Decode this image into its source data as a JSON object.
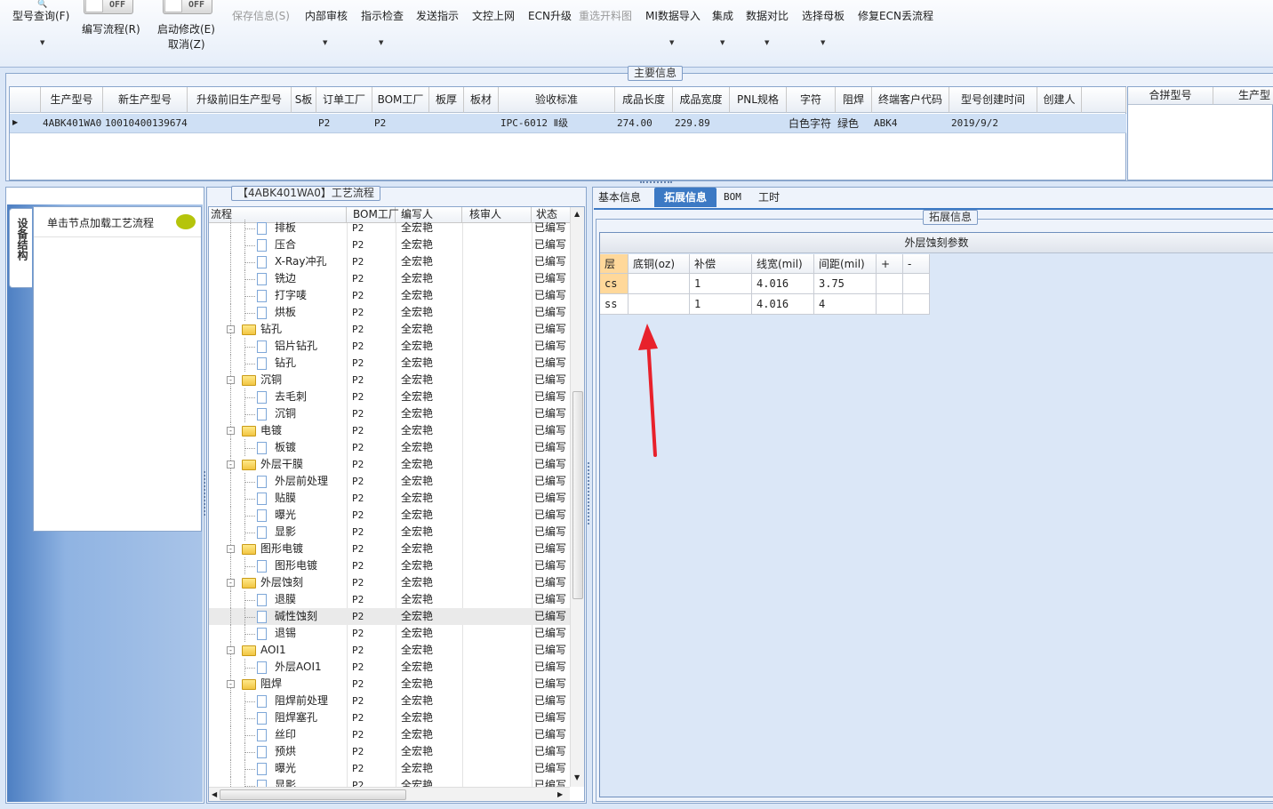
{
  "ribbon": {
    "items": [
      {
        "label": "型号查询(F)",
        "disabled": false
      },
      {
        "label": "编写流程(R)",
        "disabled": false
      },
      {
        "label": "启动修改(E)",
        "disabled": false
      },
      {
        "label": "取消(Z)",
        "disabled": false
      },
      {
        "label": "保存信息(S)",
        "disabled": true
      },
      {
        "label": "内部审核",
        "disabled": false
      },
      {
        "label": "指示检查",
        "disabled": false
      },
      {
        "label": "发送指示",
        "disabled": false
      },
      {
        "label": "文控上网",
        "disabled": false
      },
      {
        "label": "ECN升级",
        "disabled": false
      },
      {
        "label": "重选开料图",
        "disabled": true
      },
      {
        "label": "MI数据导入",
        "disabled": false
      },
      {
        "label": "集成",
        "disabled": false
      },
      {
        "label": "数据对比",
        "disabled": false
      },
      {
        "label": "选择母板",
        "disabled": false
      },
      {
        "label": "修复ECN丢流程",
        "disabled": false
      }
    ],
    "toggle_text": "OFF"
  },
  "main_info": {
    "caption": "主要信息",
    "columns": [
      "生产型号",
      "新生产型号",
      "升级前旧生产型号",
      "S板",
      "订单工厂",
      "BOM工厂",
      "板厚",
      "板材",
      "验收标准",
      "成品长度",
      "成品宽度",
      "PNL规格",
      "字符",
      "阻焊",
      "终端客户代码",
      "型号创建时间",
      "创建人"
    ],
    "row": [
      "4ABK401WA0",
      "10010400139674",
      "",
      "",
      "P2",
      "P2",
      "",
      "",
      "IPC-6012 Ⅱ级",
      "274.00",
      "229.89",
      "",
      "白色字符",
      "绿色",
      "ABK4",
      "2019/9/2",
      ""
    ],
    "side_columns": [
      "合拼型号",
      "生产型"
    ]
  },
  "left_panel": {
    "side_tab": "设备结构",
    "load_hint": "单击节点加载工艺流程"
  },
  "process": {
    "caption": "【4ABK401WA0】工艺流程",
    "columns": [
      "流程",
      "BOM工厂",
      "编写人",
      "核审人",
      "状态"
    ],
    "rows": [
      {
        "name": "排板",
        "level": 2,
        "bom": "P2",
        "author": "全宏艳",
        "reviewer": "",
        "status": "已编写"
      },
      {
        "name": "压合",
        "level": 2,
        "bom": "P2",
        "author": "全宏艳",
        "reviewer": "",
        "status": "已编写"
      },
      {
        "name": "X-Ray冲孔",
        "level": 2,
        "bom": "P2",
        "author": "全宏艳",
        "reviewer": "",
        "status": "已编写"
      },
      {
        "name": "铣边",
        "level": 2,
        "bom": "P2",
        "author": "全宏艳",
        "reviewer": "",
        "status": "已编写"
      },
      {
        "name": "打字唛",
        "level": 2,
        "bom": "P2",
        "author": "全宏艳",
        "reviewer": "",
        "status": "已编写"
      },
      {
        "name": "烘板",
        "level": 2,
        "bom": "P2",
        "author": "全宏艳",
        "reviewer": "",
        "status": "已编写"
      },
      {
        "name": "钻孔",
        "level": 1,
        "bom": "P2",
        "author": "全宏艳",
        "reviewer": "",
        "status": "已编写"
      },
      {
        "name": "铝片钻孔",
        "level": 2,
        "bom": "P2",
        "author": "全宏艳",
        "reviewer": "",
        "status": "已编写"
      },
      {
        "name": "钻孔",
        "level": 2,
        "bom": "P2",
        "author": "全宏艳",
        "reviewer": "",
        "status": "已编写"
      },
      {
        "name": "沉铜",
        "level": 1,
        "bom": "P2",
        "author": "全宏艳",
        "reviewer": "",
        "status": "已编写"
      },
      {
        "name": "去毛刺",
        "level": 2,
        "bom": "P2",
        "author": "全宏艳",
        "reviewer": "",
        "status": "已编写"
      },
      {
        "name": "沉铜",
        "level": 2,
        "bom": "P2",
        "author": "全宏艳",
        "reviewer": "",
        "status": "已编写"
      },
      {
        "name": "电镀",
        "level": 1,
        "bom": "P2",
        "author": "全宏艳",
        "reviewer": "",
        "status": "已编写"
      },
      {
        "name": "板镀",
        "level": 2,
        "bom": "P2",
        "author": "全宏艳",
        "reviewer": "",
        "status": "已编写"
      },
      {
        "name": "外层干膜",
        "level": 1,
        "bom": "P2",
        "author": "全宏艳",
        "reviewer": "",
        "status": "已编写"
      },
      {
        "name": "外层前处理",
        "level": 2,
        "bom": "P2",
        "author": "全宏艳",
        "reviewer": "",
        "status": "已编写"
      },
      {
        "name": "贴膜",
        "level": 2,
        "bom": "P2",
        "author": "全宏艳",
        "reviewer": "",
        "status": "已编写"
      },
      {
        "name": "曝光",
        "level": 2,
        "bom": "P2",
        "author": "全宏艳",
        "reviewer": "",
        "status": "已编写"
      },
      {
        "name": "显影",
        "level": 2,
        "bom": "P2",
        "author": "全宏艳",
        "reviewer": "",
        "status": "已编写"
      },
      {
        "name": "图形电镀",
        "level": 1,
        "bom": "P2",
        "author": "全宏艳",
        "reviewer": "",
        "status": "已编写"
      },
      {
        "name": "图形电镀",
        "level": 2,
        "bom": "P2",
        "author": "全宏艳",
        "reviewer": "",
        "status": "已编写"
      },
      {
        "name": "外层蚀刻",
        "level": 1,
        "bom": "P2",
        "author": "全宏艳",
        "reviewer": "",
        "status": "已编写"
      },
      {
        "name": "退膜",
        "level": 2,
        "bom": "P2",
        "author": "全宏艳",
        "reviewer": "",
        "status": "已编写"
      },
      {
        "name": "碱性蚀刻",
        "level": 2,
        "bom": "P2",
        "author": "全宏艳",
        "reviewer": "",
        "status": "已编写",
        "selected": true
      },
      {
        "name": "退锡",
        "level": 2,
        "bom": "P2",
        "author": "全宏艳",
        "reviewer": "",
        "status": "已编写"
      },
      {
        "name": "AOI1",
        "level": 1,
        "bom": "P2",
        "author": "全宏艳",
        "reviewer": "",
        "status": "已编写"
      },
      {
        "name": "外层AOI1",
        "level": 2,
        "bom": "P2",
        "author": "全宏艳",
        "reviewer": "",
        "status": "已编写"
      },
      {
        "name": "阻焊",
        "level": 1,
        "bom": "P2",
        "author": "全宏艳",
        "reviewer": "",
        "status": "已编写"
      },
      {
        "name": "阻焊前处理",
        "level": 2,
        "bom": "P2",
        "author": "全宏艳",
        "reviewer": "",
        "status": "已编写"
      },
      {
        "name": "阻焊塞孔",
        "level": 2,
        "bom": "P2",
        "author": "全宏艳",
        "reviewer": "",
        "status": "已编写"
      },
      {
        "name": "丝印",
        "level": 2,
        "bom": "P2",
        "author": "全宏艳",
        "reviewer": "",
        "status": "已编写"
      },
      {
        "name": "预烘",
        "level": 2,
        "bom": "P2",
        "author": "全宏艳",
        "reviewer": "",
        "status": "已编写"
      },
      {
        "name": "曝光",
        "level": 2,
        "bom": "P2",
        "author": "全宏艳",
        "reviewer": "",
        "status": "已编写"
      },
      {
        "name": "显影",
        "level": 2,
        "bom": "P2",
        "author": "全宏艳",
        "reviewer": "",
        "status": "已编写"
      }
    ]
  },
  "right_panel": {
    "tabs": [
      "基本信息",
      "拓展信息",
      "BOM",
      "工时"
    ],
    "active_tab": 1,
    "group_caption": "拓展信息",
    "grid_title": "外层蚀刻参数",
    "grid_columns": [
      "层",
      "底铜(oz)",
      "补偿",
      "线宽(mil)",
      "间距(mil)",
      "+",
      "-"
    ],
    "grid_rows": [
      [
        "cs",
        "",
        "1",
        "4.016",
        "3.75",
        "",
        ""
      ],
      [
        "ss",
        "",
        "1",
        "4.016",
        "4",
        "",
        ""
      ]
    ]
  },
  "colors": {
    "selection_row": "#cfe0f5",
    "active_tab": "#3c79c4",
    "accent_orange": "#ffd89a",
    "arrow": "#e8212b"
  }
}
